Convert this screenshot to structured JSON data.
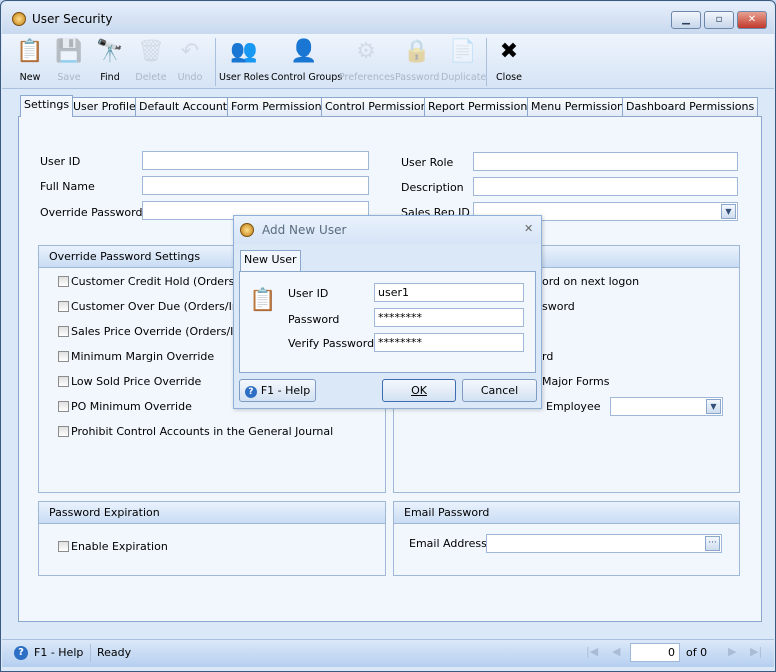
{
  "window": {
    "title": "User Security",
    "min": "▁",
    "max": "▫",
    "close": "✕"
  },
  "toolbar": [
    {
      "label": "New",
      "icon": "📋",
      "enabled": true,
      "name": "new"
    },
    {
      "label": "Save",
      "icon": "💾",
      "enabled": false,
      "name": "save"
    },
    {
      "label": "Find",
      "icon": "🔭",
      "enabled": true,
      "name": "find"
    },
    {
      "label": "Delete",
      "icon": "🗑",
      "enabled": false,
      "name": "delete"
    },
    {
      "label": "Undo",
      "icon": "↶",
      "enabled": false,
      "name": "undo"
    },
    {
      "label": "User Roles",
      "icon": "👥",
      "enabled": true,
      "name": "user-roles"
    },
    {
      "label": "Control Groups",
      "icon": "👤",
      "enabled": true,
      "name": "control-groups"
    },
    {
      "label": "Preferences",
      "icon": "⚙",
      "enabled": false,
      "name": "preferences"
    },
    {
      "label": "Password",
      "icon": "🔒",
      "enabled": false,
      "name": "password"
    },
    {
      "label": "Duplicate",
      "icon": "📄",
      "enabled": false,
      "name": "duplicate"
    },
    {
      "label": "Close",
      "icon": "✖",
      "enabled": true,
      "name": "close"
    }
  ],
  "tabs": [
    "Settings",
    "User Profile",
    "Default Accounts",
    "Form Permissions",
    "Control Permissions",
    "Report Permissions",
    "Menu Permissions",
    "Dashboard Permissions"
  ],
  "form": {
    "user_id": "User ID",
    "full_name": "Full Name",
    "override_password": "Override Password",
    "user_role": "User Role",
    "description": "Description",
    "sales_rep_id": "Sales Rep ID"
  },
  "override_group": {
    "title": "Override Password Settings",
    "items": [
      "Customer Credit Hold (Orders/Inv",
      "Customer Over Due (Orders/Invo",
      "Sales Price Override (Orders/Invo",
      "Minimum Margin Override",
      "Low Sold Price Override",
      "PO Minimum Override",
      "Prohibit Control Accounts in the General Journal"
    ]
  },
  "right_group": {
    "fragments": [
      "ord on next logon",
      "sword",
      "rd",
      "Major Forms",
      "Employee"
    ]
  },
  "expiration": {
    "title": "Password Expiration",
    "enable": "Enable Expiration"
  },
  "email": {
    "title": "Email Password",
    "label": "Email Address",
    "browse": "···"
  },
  "status": {
    "help": "F1 - Help",
    "text": "Ready",
    "page": "0",
    "of": "of 0"
  },
  "dialog": {
    "title": "Add New User",
    "tab": "New User",
    "user_id_label": "User ID",
    "user_id": "user1",
    "password_label": "Password",
    "password": "********",
    "verify_label": "Verify Password",
    "verify": "********",
    "help": "F1 - Help",
    "ok": "OK",
    "cancel": "Cancel",
    "close": "✕"
  }
}
